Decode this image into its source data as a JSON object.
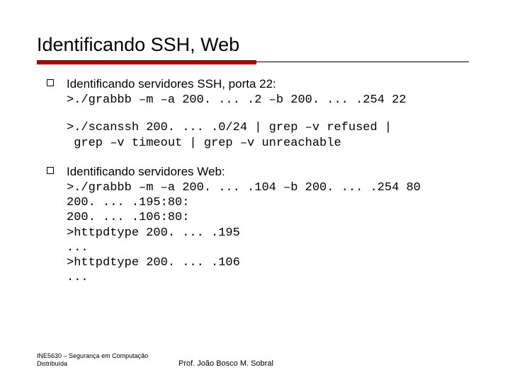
{
  "title": "Identificando SSH, Web",
  "section1": {
    "heading": "Identificando servidores SSH, porta 22:",
    "line1": ">./grabbb –m –a 200. ... .2 –b 200. ... .254 22",
    "line2": ">./scanssh 200. ... .0/24 | grep –v refused | \n grep –v timeout | grep –v unreachable"
  },
  "section2": {
    "heading": "Identificando servidores Web:",
    "code": ">./grabbb –m –a 200. ... .104 –b 200. ... .254 80\n200. ... .195:80:\n200. ... .106:80:\n>httpdtype 200. ... .195\n...\n>httpdtype 200. ... .106\n..."
  },
  "footer": {
    "left": "INE5630 – Segurança em Computação Distribuída",
    "center": "Prof. João Bosco M. Sobral"
  }
}
